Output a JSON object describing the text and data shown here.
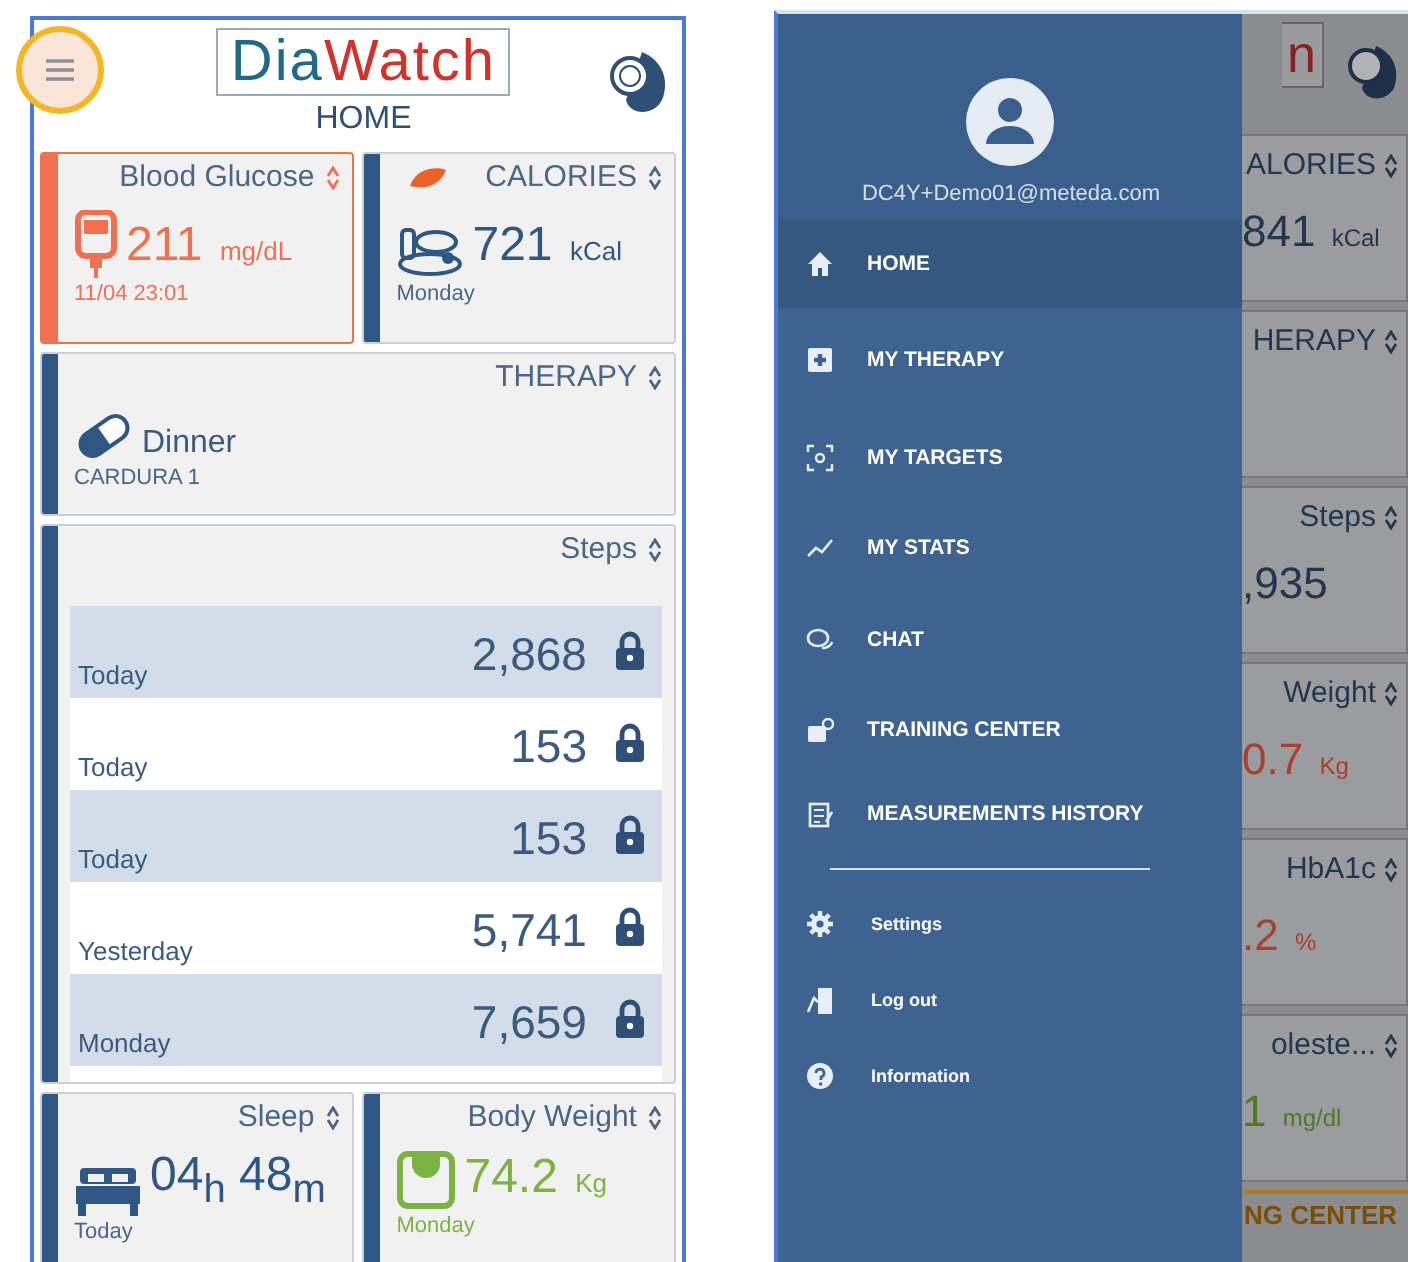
{
  "home": {
    "logo_left": "Dia",
    "logo_right": "Watch",
    "title": "HOME",
    "tiles": [
      {
        "kind": "glucose",
        "title": "Blood Glucose",
        "value": "211",
        "unit": "mg/dL",
        "caption": "11/04 23:01",
        "color": "#f07050",
        "alert": true
      },
      {
        "kind": "calories",
        "title": "CALORIES",
        "value": "721",
        "unit": "kCal",
        "caption": "Monday",
        "color": "#2f5784",
        "alert": false
      },
      {
        "kind": "therapy",
        "title": "THERAPY",
        "value": "Dinner",
        "caption": "CARDURA 1",
        "color": "#2f5784",
        "alert": false
      },
      {
        "kind": "steps",
        "title": "Steps",
        "rows": [
          {
            "label": "Today",
            "value": "2,868"
          },
          {
            "label": "Today",
            "value": "153"
          },
          {
            "label": "Today",
            "value": "153"
          },
          {
            "label": "Yesterday",
            "value": "5,741"
          },
          {
            "label": "Monday",
            "value": "7,659"
          }
        ],
        "alert": false
      },
      {
        "kind": "sleep",
        "title": "Sleep",
        "value": "04$_{h}$ 48$_{m}$",
        "caption": "Today",
        "color": "#2f5784",
        "alert": false
      },
      {
        "kind": "weight",
        "title": "Body Weight",
        "value": "74.2",
        "unit": "Kg",
        "caption": "Monday",
        "color": "#7cb342",
        "alert": false
      }
    ]
  },
  "drawer": {
    "email": "DC4Y+Demo01@meteda.com",
    "items": [
      {
        "label": "HOME",
        "selected": true
      },
      {
        "label": "MY THERAPY",
        "selected": false
      },
      {
        "label": "MY TARGETS",
        "selected": false
      },
      {
        "label": "MY STATS",
        "selected": false
      },
      {
        "label": "CHAT",
        "selected": false
      },
      {
        "label": "TRAINING CENTER",
        "selected": false
      },
      {
        "label": "MEASUREMENTS HISTORY",
        "selected": false
      }
    ],
    "secondary_items": [
      {
        "label": "Settings"
      },
      {
        "label": "Log out"
      },
      {
        "label": "Information"
      }
    ]
  },
  "behind": {
    "logo_fragment": "n",
    "tiles": [
      {
        "kind": "tile",
        "title": "ALORIES",
        "value": "841",
        "unit": "kCal",
        "color": "#23364d"
      },
      {
        "kind": "tile",
        "title": "HERAPY"
      },
      {
        "kind": "tile",
        "title": "Steps",
        "value": ",935",
        "color": "#23364d"
      },
      {
        "kind": "tile",
        "title": "Weight",
        "value": "0.7",
        "unit": "Kg",
        "color": "#a8402a"
      },
      {
        "kind": "tile",
        "title": "HbA1c",
        "value": ".2",
        "unit": "%",
        "color": "#a8402a"
      },
      {
        "kind": "tile",
        "title": "oleste...",
        "value": "1",
        "unit": "mg/dl",
        "color": "#4f7a22"
      },
      {
        "kind": "banner",
        "title": "NG CENTER"
      }
    ]
  }
}
